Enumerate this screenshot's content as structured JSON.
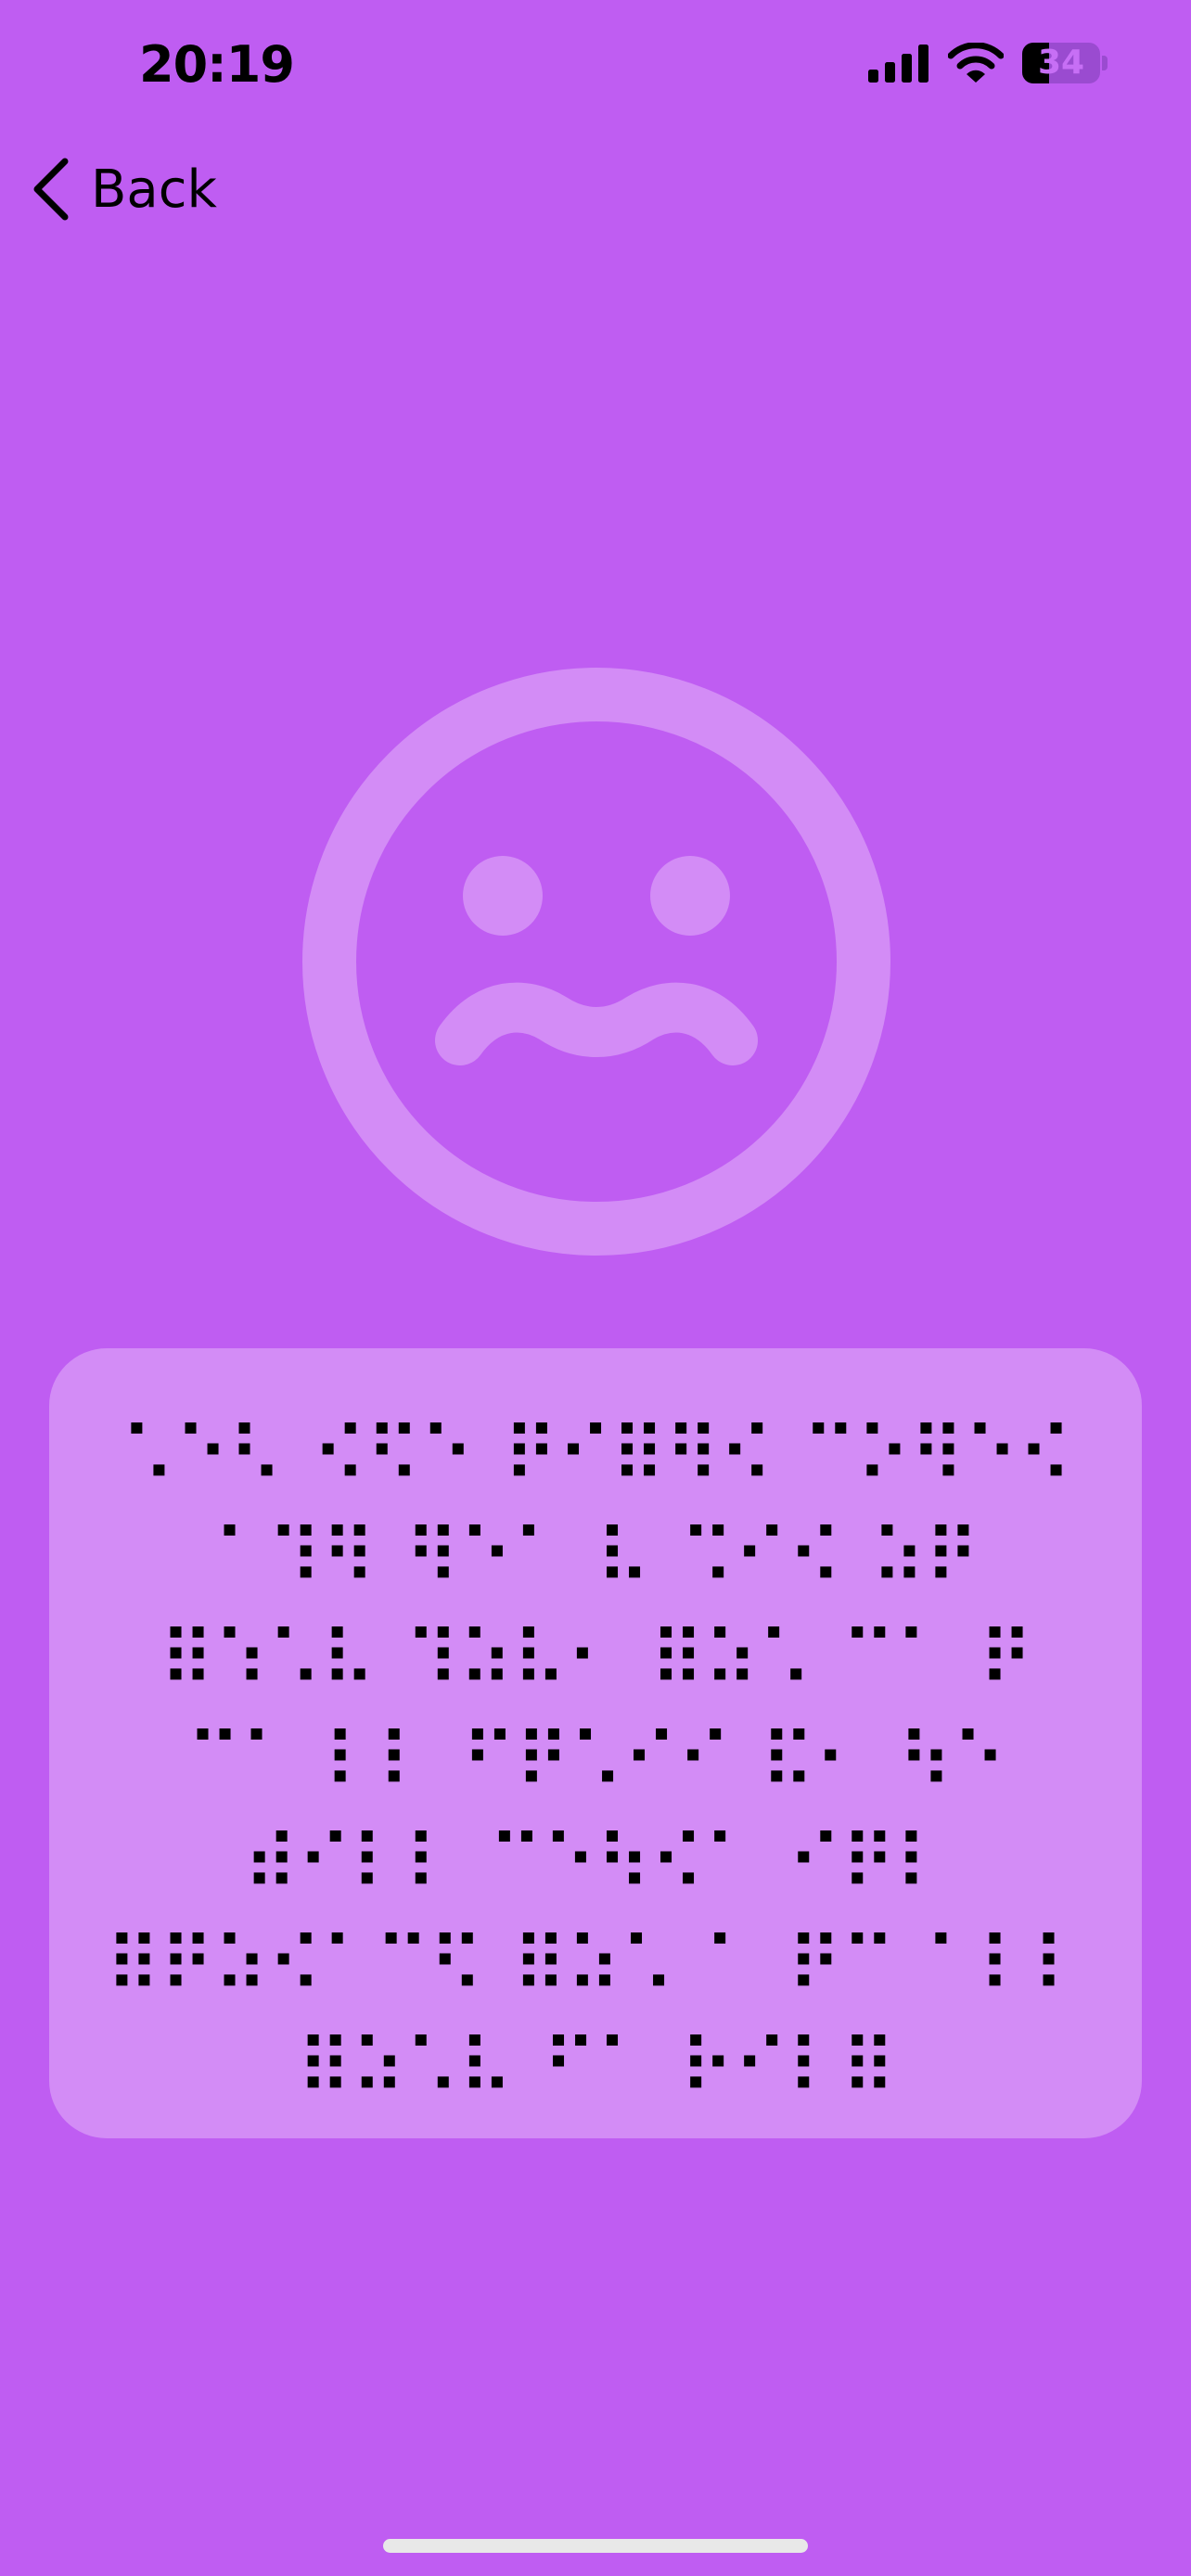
{
  "status_bar": {
    "time": "20:19",
    "battery_percent": "34",
    "battery_level": 0.34,
    "signal_bars": 4,
    "wifi_icon": "wifi-icon",
    "cellular_icon": "cellular-signal-icon"
  },
  "navigation": {
    "back_label": "Back",
    "back_icon": "chevron-left-icon"
  },
  "hero": {
    "icon": "worried-face-icon",
    "icon_color": "#d38cf6"
  },
  "message_card": {
    "braille_text": "⠡⠑⠣ ⠪⠫⠑ ⠟⠊⠿⠻⠪ ⠉⠕⠻⠑⠪ ⠁⠹⠻ ⠻⠑⠁ ⠧ ⠩⠊⠪ ⠵⠟ ⠿⠱⠡⠧ ⠹⠵⠧⠂ ⠿⠵⠡ ⠉⠁ ⠟ ⠉⠁ ⠇⠇ ⠋⠟⠡⠊⠊ ⠯⠂ ⠳⠑ ⠾⠊⠇⠇ ⠉⠑⠳⠪⠁ ⠊⠟⠇ ⠿⠟⠵⠪⠁⠉⠫ ⠿⠵⠡ ⠁ ⠟⠉ ⠁⠇⠇ ⠿⠵⠡⠧ ⠋⠁ ⠗⠊⠇⠿",
    "background": "#d38cf6"
  },
  "colors": {
    "background": "#bf5df2",
    "accent_light": "#d38cf6",
    "text": "#000000"
  }
}
